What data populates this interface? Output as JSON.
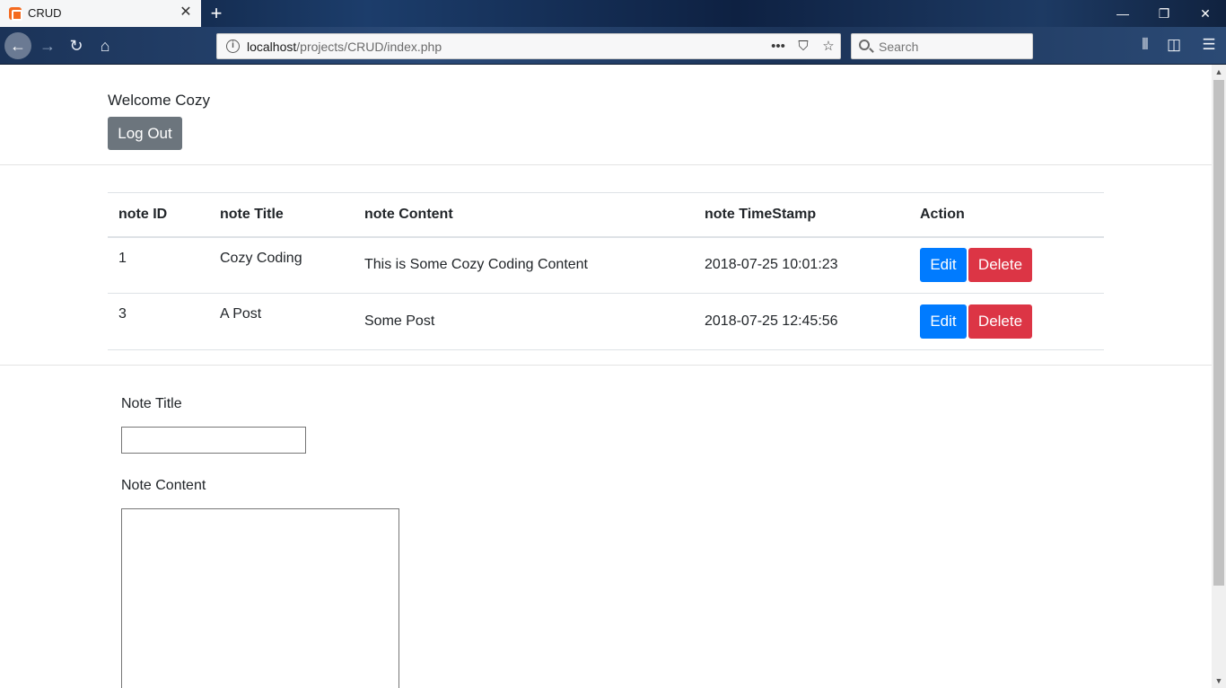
{
  "browser": {
    "tab_title": "CRUD",
    "url_host": "localhost",
    "url_path": "/projects/CRUD/index.php",
    "search_placeholder": "Search"
  },
  "header": {
    "welcome": "Welcome Cozy",
    "logout_label": "Log Out"
  },
  "table": {
    "headers": [
      "note ID",
      "note Title",
      "note Content",
      "note TimeStamp",
      "Action"
    ],
    "rows": [
      {
        "id": "1",
        "title": "Cozy Coding",
        "content": "This is Some Cozy Coding Content",
        "timestamp": "2018-07-25 10:01:23",
        "edit": "Edit",
        "delete": "Delete"
      },
      {
        "id": "3",
        "title": "A Post",
        "content": "Some Post",
        "timestamp": "2018-07-25 12:45:56",
        "edit": "Edit",
        "delete": "Delete"
      }
    ]
  },
  "form": {
    "title_label": "Note Title",
    "title_value": "",
    "content_label": "Note Content",
    "content_value": ""
  },
  "colors": {
    "edit": "#007bff",
    "delete": "#dc3545",
    "logout": "#6c757d"
  }
}
